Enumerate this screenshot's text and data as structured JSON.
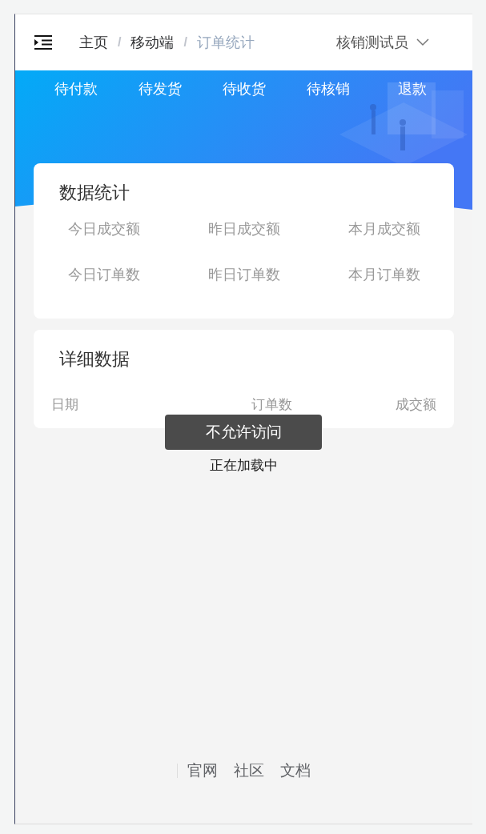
{
  "header": {
    "breadcrumb": [
      {
        "kind": "link",
        "text": "主页"
      },
      {
        "kind": "separator",
        "text": "/"
      },
      {
        "kind": "link",
        "text": "移动端"
      },
      {
        "kind": "separator",
        "text": "/"
      },
      {
        "kind": "current",
        "text": "订单统计"
      }
    ],
    "user": "核销测试员"
  },
  "tabs": [
    {
      "label": "待付款",
      "selected": false
    },
    {
      "label": "待发货",
      "selected": false
    },
    {
      "label": "待收货",
      "selected": false
    },
    {
      "label": "待核销",
      "selected": false
    },
    {
      "label": "退款",
      "selected": false
    }
  ],
  "stats_card": {
    "title": "数据统计",
    "items": [
      "今日成交额",
      "昨日成交额",
      "本月成交额",
      "今日订单数",
      "昨日订单数",
      "本月订单数"
    ]
  },
  "detail_card": {
    "title": "详细数据",
    "columns": [
      "日期",
      "订单数",
      "成交额"
    ]
  },
  "loading_text": "正在加载中",
  "toast": "不允许访问",
  "footer_links": [
    "官网",
    "社区",
    "文档"
  ]
}
